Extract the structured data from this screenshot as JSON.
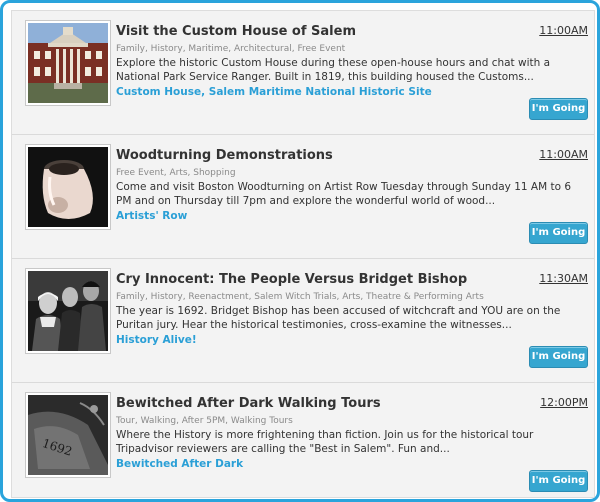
{
  "colors": {
    "frame": "#2aa4dc",
    "link": "#2a9fd6",
    "button": "#36a6d0"
  },
  "events": [
    {
      "title": "Visit the Custom House of Salem",
      "time": "11:00AM",
      "tags": "Family, History, Maritime, Architectural, Free Event",
      "description": "Explore the historic Custom House during these open-house hours and chat with a National Park Service Ranger. Built in 1819, this building housed the Customs...",
      "location": "Custom House, Salem Maritime National Historic Site",
      "button": "I'm Going",
      "image": "custom-house-photo"
    },
    {
      "title": "Woodturning Demonstrations",
      "time": "11:00AM",
      "tags": "Free Event, Arts, Shopping",
      "description": "Come and visit Boston Woodturning on Artist Row Tuesday through Sunday 11 AM to 6 PM and on Thursday till 7pm and explore the wonderful world of wood...",
      "location": "Artists' Row",
      "button": "I'm Going",
      "image": "wood-vessel-photo"
    },
    {
      "title": "Cry Innocent: The People Versus Bridget Bishop",
      "time": "11:30AM",
      "tags": "Family, History, Reenactment, Salem Witch Trials, Arts, Theatre & Performing Arts",
      "description": "The year is 1692. Bridget Bishop has been accused of witchcraft and YOU are on the Puritan jury. Hear the historical testimonies, cross-examine the witnesses...",
      "location": "History Alive!",
      "button": "I'm Going",
      "image": "actors-photo"
    },
    {
      "title": "Bewitched After Dark Walking Tours",
      "time": "12:00PM",
      "tags": "Tour, Walking, After 5PM, Walking Tours",
      "description": "Where the History is more frightening than fiction. Join us for the historical tour Tripadvisor reviewers are calling the \"Best in Salem\". Fun and...",
      "location": "Bewitched After Dark",
      "button": "I'm Going",
      "image": "gravestone-photo"
    }
  ]
}
